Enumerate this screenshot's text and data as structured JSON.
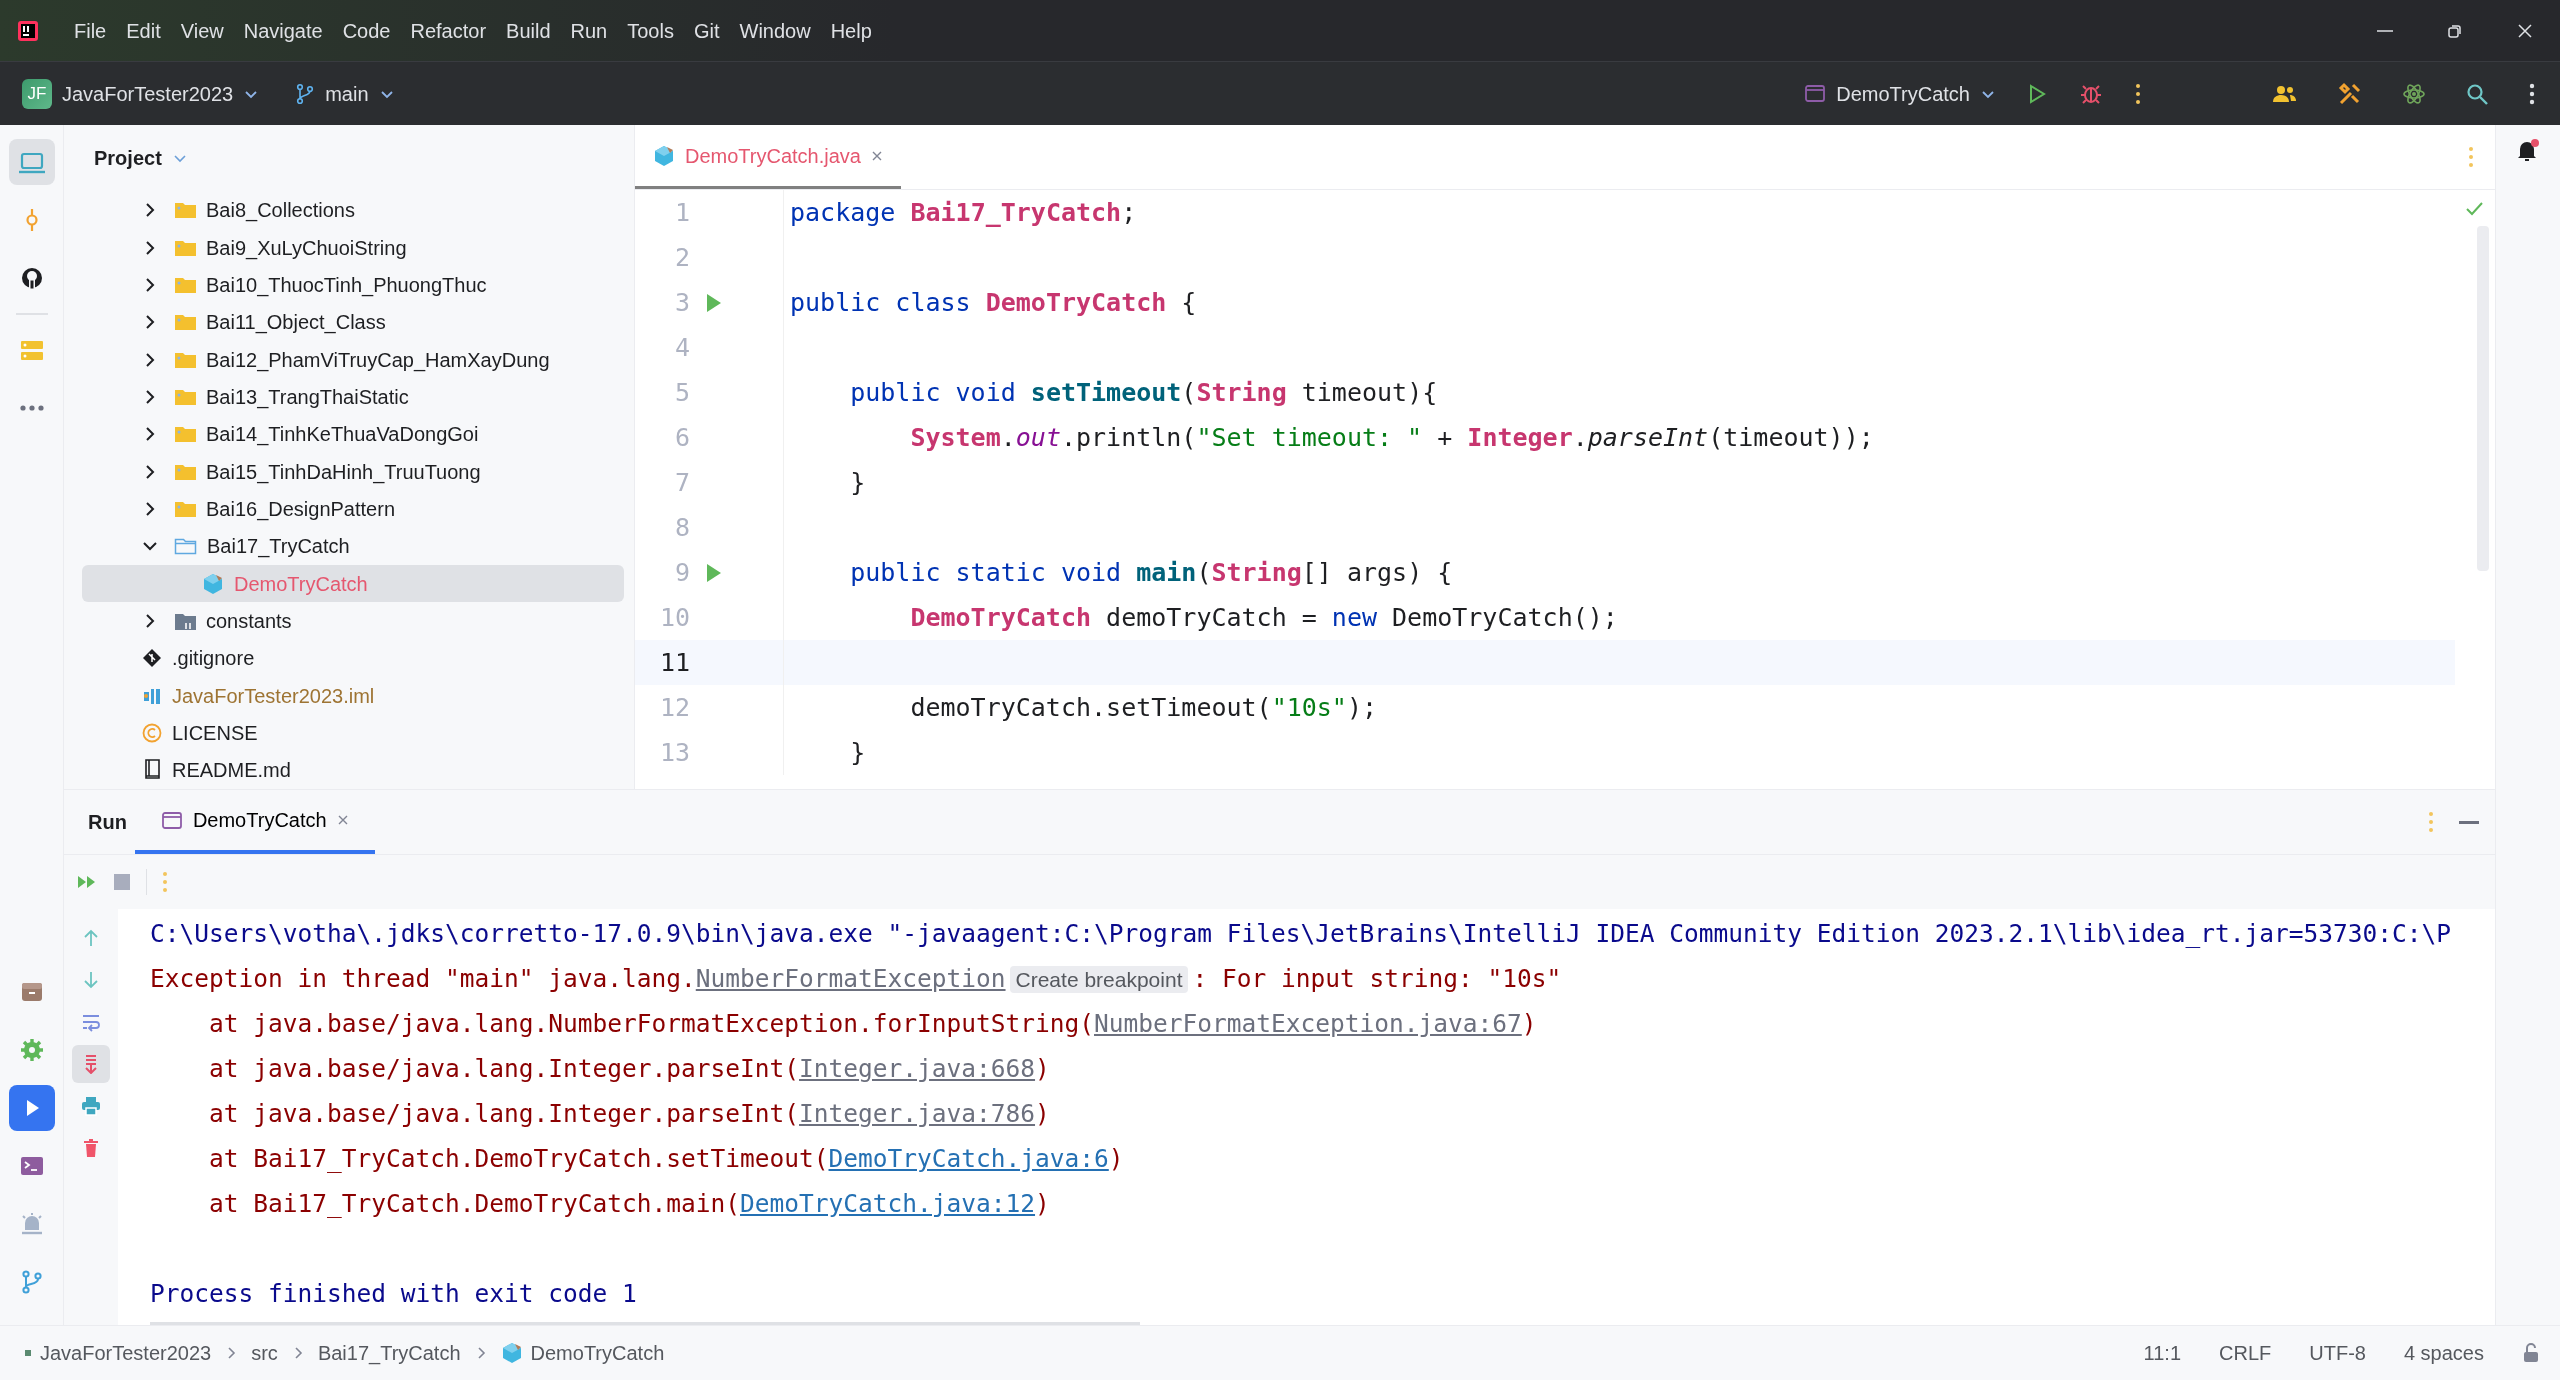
{
  "title_bar": {
    "menu": [
      "File",
      "Edit",
      "View",
      "Navigate",
      "Code",
      "Refactor",
      "Build",
      "Run",
      "Tools",
      "Git",
      "Window",
      "Help"
    ]
  },
  "toolbar": {
    "project_initials": "JF",
    "project_name": "JavaForTester2023",
    "branch": "main",
    "run_config": "DemoTryCatch"
  },
  "left_strip": {
    "top": [
      {
        "kind": "project",
        "selected": true
      },
      {
        "kind": "commit",
        "selected": false
      },
      {
        "kind": "github",
        "selected": false
      },
      {
        "kind": "structure",
        "selected": false
      },
      {
        "kind": "more",
        "selected": false
      }
    ],
    "bottom": [
      {
        "kind": "services",
        "selected": false
      },
      {
        "kind": "settings",
        "selected": false
      },
      {
        "kind": "run",
        "selected": true
      },
      {
        "kind": "terminal",
        "selected": false
      },
      {
        "kind": "problems",
        "selected": false
      },
      {
        "kind": "git",
        "selected": false
      }
    ]
  },
  "project_panel": {
    "title": "Project",
    "tree": [
      {
        "label": "Bai8_Collections",
        "kind": "folder",
        "expanded": false,
        "selected": false
      },
      {
        "label": "Bai9_XuLyChuoiString",
        "kind": "folder",
        "expanded": false,
        "selected": false
      },
      {
        "label": "Bai10_ThuocTinh_PhuongThuc",
        "kind": "folder",
        "expanded": false,
        "selected": false
      },
      {
        "label": "Bai11_Object_Class",
        "kind": "folder",
        "expanded": false,
        "selected": false
      },
      {
        "label": "Bai12_PhamViTruyCap_HamXayDung",
        "kind": "folder",
        "expanded": false,
        "selected": false
      },
      {
        "label": "Bai13_TrangThaiStatic",
        "kind": "folder",
        "expanded": false,
        "selected": false
      },
      {
        "label": "Bai14_TinhKeThuaVaDongGoi",
        "kind": "folder",
        "expanded": false,
        "selected": false
      },
      {
        "label": "Bai15_TinhDaHinh_TruuTuong",
        "kind": "folder",
        "expanded": false,
        "selected": false
      },
      {
        "label": "Bai16_DesignPattern",
        "kind": "folder",
        "expanded": false,
        "selected": false
      },
      {
        "label": "Bai17_TryCatch",
        "kind": "folder",
        "expanded": true,
        "selected": false,
        "children": [
          {
            "label": "DemoTryCatch",
            "kind": "class",
            "selected": true,
            "color": "#e5576f"
          }
        ]
      },
      {
        "label": "constants",
        "kind": "package",
        "expanded": false,
        "selected": false
      },
      {
        "label": ".gitignore",
        "kind": "gitignore",
        "selected": false
      },
      {
        "label": "JavaForTester2023.iml",
        "kind": "module",
        "selected": false,
        "color": "#9e7433"
      },
      {
        "label": "LICENSE",
        "kind": "license",
        "selected": false
      },
      {
        "label": "README.md",
        "kind": "readme",
        "selected": false
      }
    ]
  },
  "editor": {
    "tabs": [
      {
        "label": "DemoTryCatch.java",
        "selected": true,
        "color": "#e5576f"
      }
    ],
    "lines": [
      {
        "number": "1",
        "run": false,
        "current": false,
        "tokens": [
          {
            "t": "package ",
            "kind": "kw"
          },
          {
            "t": "Bai17_TryCatch",
            "kind": "cls"
          },
          {
            "t": ";",
            "kind": "plain"
          }
        ]
      },
      {
        "number": "2",
        "run": false,
        "current": false
      },
      {
        "number": "3",
        "run": true,
        "current": false,
        "tokens": [
          {
            "t": "public class ",
            "kind": "kw"
          },
          {
            "t": "DemoTryCatch",
            "kind": "cls"
          },
          {
            "t": " {",
            "kind": "plain"
          }
        ]
      },
      {
        "number": "4",
        "run": false,
        "current": false
      },
      {
        "number": "5",
        "run": false,
        "current": false,
        "tokens": [
          {
            "t": "    public void ",
            "kind": "kw"
          },
          {
            "t": "setTimeout",
            "kind": "fn"
          },
          {
            "t": "(",
            "kind": "plain"
          },
          {
            "t": "String",
            "kind": "cls"
          },
          {
            "t": " timeout){",
            "kind": "plain"
          }
        ]
      },
      {
        "number": "6",
        "run": false,
        "current": false,
        "tokens": [
          {
            "t": "        System",
            "kind": "cls"
          },
          {
            "t": ".",
            "kind": "plain"
          },
          {
            "t": "out",
            "kind": "fld"
          },
          {
            "t": ".println(",
            "kind": "plain"
          },
          {
            "t": "\"Set timeout: \"",
            "kind": "str"
          },
          {
            "t": " + ",
            "kind": "plain"
          },
          {
            "t": "Integer",
            "kind": "cls"
          },
          {
            "t": ".",
            "kind": "plain"
          },
          {
            "t": "parseInt",
            "kind": "ital"
          },
          {
            "t": "(timeout));",
            "kind": "plain"
          }
        ]
      },
      {
        "number": "7",
        "run": false,
        "current": false,
        "tokens": [
          {
            "t": "    }",
            "kind": "plain"
          }
        ]
      },
      {
        "number": "8",
        "run": false,
        "current": false
      },
      {
        "number": "9",
        "run": true,
        "current": false,
        "tokens": [
          {
            "t": "    public static void ",
            "kind": "kw"
          },
          {
            "t": "main",
            "kind": "fn"
          },
          {
            "t": "(",
            "kind": "plain"
          },
          {
            "t": "String",
            "kind": "cls"
          },
          {
            "t": "[] args) {",
            "kind": "plain"
          }
        ]
      },
      {
        "number": "10",
        "run": false,
        "current": false,
        "tokens": [
          {
            "t": "        DemoTryCatch",
            "kind": "cls"
          },
          {
            "t": " demoTryCatch = ",
            "kind": "plain"
          },
          {
            "t": "new",
            "kind": "kw"
          },
          {
            "t": " DemoTryCatch();",
            "kind": "plain"
          }
        ]
      },
      {
        "number": "11",
        "run": false,
        "current": true
      },
      {
        "number": "12",
        "run": false,
        "current": false,
        "tokens": [
          {
            "t": "        demoTryCatch.setTimeout(",
            "kind": "plain"
          },
          {
            "t": "\"10s\"",
            "kind": "str"
          },
          {
            "t": ");",
            "kind": "plain"
          }
        ]
      },
      {
        "number": "13",
        "run": false,
        "current": false,
        "tokens": [
          {
            "t": "    }",
            "kind": "plain"
          }
        ]
      }
    ]
  },
  "run_panel": {
    "title": "Run",
    "tabs": [
      {
        "label": "DemoTryCatch",
        "selected": true
      }
    ],
    "tools": [
      {
        "kind": "up",
        "selected": false
      },
      {
        "kind": "down",
        "selected": false
      },
      {
        "kind": "wrap",
        "selected": false
      },
      {
        "kind": "scroll-end",
        "selected": true
      },
      {
        "kind": "print",
        "selected": false
      },
      {
        "kind": "clear",
        "selected": false
      }
    ],
    "console": [
      {
        "segments": [
          {
            "t": "C:\\Users\\votha\\.jdks\\corretto-17.0.9\\bin\\java.exe \"-javaagent:C:\\Program Files\\JetBrains\\IntelliJ IDEA Community Edition 2023.2.1\\lib\\idea_rt.jar=53730:C:\\P",
            "kind": "cmd"
          }
        ]
      },
      {
        "segments": [
          {
            "t": "Exception in thread \"main\" java.lang.",
            "kind": "err"
          },
          {
            "t": "NumberFormatException",
            "kind": "lib"
          },
          {
            "t": "Create breakpoint",
            "kind": "hint"
          },
          {
            "t": ": For input string: \"10s\"",
            "kind": "err"
          }
        ]
      },
      {
        "segments": [
          {
            "t": "    at java.base/java.lang.NumberFormatException.forInputString(",
            "kind": "err"
          },
          {
            "t": "NumberFormatException.java:67",
            "kind": "lib"
          },
          {
            "t": ")",
            "kind": "err"
          }
        ]
      },
      {
        "segments": [
          {
            "t": "    at java.base/java.lang.Integer.parseInt(",
            "kind": "err"
          },
          {
            "t": "Integer.java:668",
            "kind": "lib"
          },
          {
            "t": ")",
            "kind": "err"
          }
        ]
      },
      {
        "segments": [
          {
            "t": "    at java.base/java.lang.Integer.parseInt(",
            "kind": "err"
          },
          {
            "t": "Integer.java:786",
            "kind": "lib"
          },
          {
            "t": ")",
            "kind": "err"
          }
        ]
      },
      {
        "segments": [
          {
            "t": "    at Bai17_TryCatch.DemoTryCatch.setTimeout(",
            "kind": "err"
          },
          {
            "t": "DemoTryCatch.java:6",
            "kind": "src"
          },
          {
            "t": ")",
            "kind": "err"
          }
        ]
      },
      {
        "segments": [
          {
            "t": "    at Bai17_TryCatch.DemoTryCatch.main(",
            "kind": "err"
          },
          {
            "t": "DemoTryCatch.java:12",
            "kind": "src"
          },
          {
            "t": ")",
            "kind": "err"
          }
        ]
      }
    ],
    "exit_message": "Process finished with exit code 1"
  },
  "status_bar": {
    "breadcrumbs": [
      {
        "label": "JavaForTester2023",
        "kind": "module"
      },
      {
        "label": "src",
        "kind": "plain"
      },
      {
        "label": "Bai17_TryCatch",
        "kind": "plain"
      },
      {
        "label": "DemoTryCatch",
        "kind": "class"
      }
    ],
    "items": [
      "11:1",
      "CRLF",
      "UTF-8",
      "4 spaces"
    ]
  }
}
